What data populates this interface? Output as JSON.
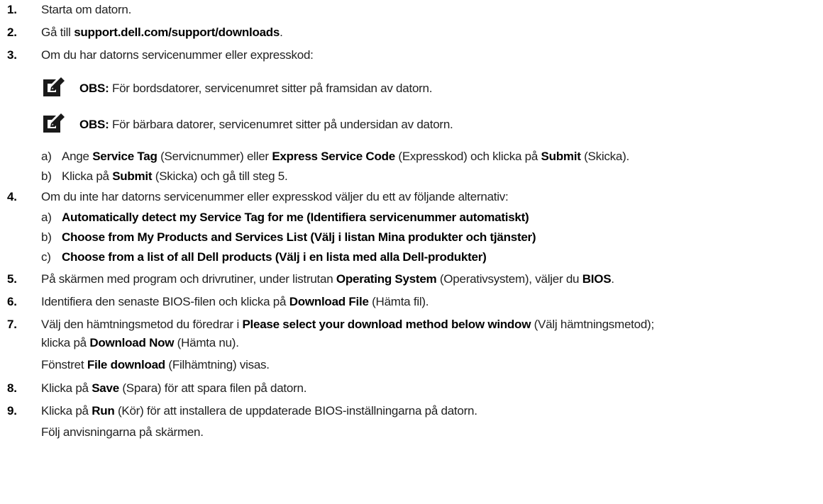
{
  "steps": {
    "s1": {
      "num": "1.",
      "text": "Starta om datorn."
    },
    "s2": {
      "num": "2.",
      "pre": "Gå till ",
      "link": "support.dell.com/support/downloads",
      "post": "."
    },
    "s3": {
      "num": "3.",
      "text": "Om du har datorns servicenummer eller expresskod:",
      "note1": {
        "label": "OBS:",
        "text": " För bordsdatorer, servicenumret sitter på framsidan av datorn."
      },
      "note2": {
        "label": "OBS:",
        "text": " För bärbara datorer, servicenumret sitter på undersidan av datorn."
      },
      "a": {
        "label": "a)",
        "t1": "Ange ",
        "b1": "Service Tag",
        "t2": " (Servicnummer) eller ",
        "b2": "Express Service Code",
        "t3": " (Expresskod) och klicka på ",
        "b3": "Submit",
        "t4": " (Skicka)."
      },
      "b": {
        "label": "b)",
        "t1": "Klicka på ",
        "b1": "Submit",
        "t2": " (Skicka) och gå till steg 5."
      }
    },
    "s4": {
      "num": "4.",
      "text": "Om du inte har datorns servicenummer eller expresskod väljer du ett av följande alternativ:",
      "a": {
        "label": "a)",
        "text": "Automatically detect my Service Tag for me (Identifiera servicenummer automatiskt)"
      },
      "b": {
        "label": "b)",
        "text": "Choose from My Products and Services List (Välj i listan Mina produkter och tjänster)"
      },
      "c": {
        "label": "c)",
        "text": "Choose from a list of all Dell products (Välj i en lista med alla Dell-produkter)"
      }
    },
    "s5": {
      "num": "5.",
      "t1": "På skärmen med program och drivrutiner, under listrutan ",
      "b1": "Operating System",
      "t2": " (Operativsystem), väljer du ",
      "b2": "BIOS",
      "t3": "."
    },
    "s6": {
      "num": "6.",
      "t1": "Identifiera den senaste BIOS-filen och klicka på ",
      "b1": "Download File",
      "t2": " (Hämta fil)."
    },
    "s7": {
      "num": "7.",
      "t1": "Välj den hämtningsmetod du föredrar i ",
      "b1": "Please select your download method below window",
      "t2": " (Välj hämtningsmetod);",
      "l2a": "klicka på ",
      "l2b": "Download Now",
      "l2c": " (Hämta nu).",
      "f1": "Fönstret ",
      "fb": "File download",
      "f2": " (Filhämtning) visas."
    },
    "s8": {
      "num": "8.",
      "t1": "Klicka på ",
      "b1": "Save",
      "t2": " (Spara) för att spara filen på datorn."
    },
    "s9": {
      "num": "9.",
      "t1": "Klicka på ",
      "b1": "Run",
      "t2": " (Kör) för att installera de uppdaterade BIOS-inställningarna på datorn.",
      "follow": "Följ anvisningarna på skärmen."
    }
  },
  "icons": {
    "note": "pencil-note-icon"
  },
  "colors": {
    "text": "#222222",
    "bold": "#000000",
    "icon_bg": "#1a1a1a"
  }
}
